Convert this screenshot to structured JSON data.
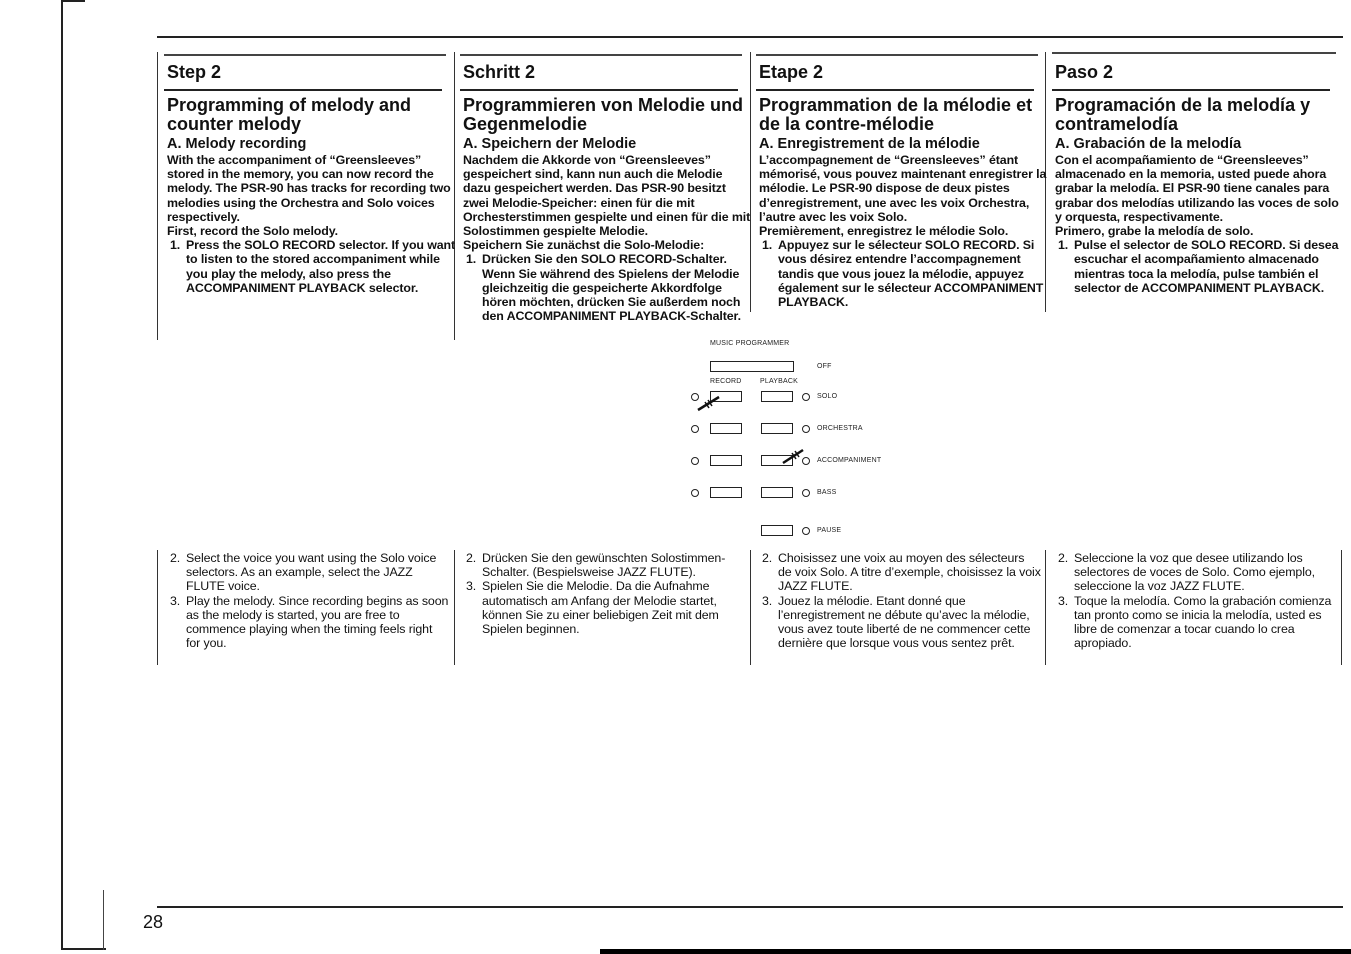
{
  "page_number": "28",
  "columns": [
    {
      "lang": "en",
      "step": "Step 2",
      "heading": "Programming of melody and counter melody",
      "subheading": "A. Melody recording",
      "intro": "With the accompaniment of “Greensleeves” stored in the memory, you can now record the melody. The PSR-90 has tracks for recording two melodies using the Orchestra and Solo voices respectively.",
      "first": "First, record the Solo melody.",
      "steps_top": [
        {
          "num": "1.",
          "text": "Press the SOLO RECORD selector. If you want to listen to the stored accompaniment while you play the melody, also press the ACCOMPANIMENT PLAYBACK selector."
        }
      ],
      "steps_bottom": [
        {
          "num": "2.",
          "text": "Select the voice you want using the Solo voice selectors. As an example, select the JAZZ FLUTE voice."
        },
        {
          "num": "3.",
          "text": "Play the melody. Since recording begins as soon as the melody is started, you are free to commence playing when the timing feels right for you."
        }
      ]
    },
    {
      "lang": "de",
      "step": "Schritt 2",
      "heading": "Programmieren von Melodie und Gegenmelodie",
      "subheading": "A. Speichern der Melodie",
      "intro": "Nachdem die Akkorde von “Greensleeves” gespeichert sind, kann nun auch die Melodie dazu gespeichert werden. Das PSR-90 besitzt zwei Melodie-Speicher: einen für die mit Orchesterstimmen gespielte und einen für die mit Solostimmen gespielte Melodie.",
      "first": "Speichern Sie zunächst die Solo-Melodie:",
      "steps_top": [
        {
          "num": "1.",
          "text": "Drücken Sie den SOLO RECORD-Schalter. Wenn Sie während des Spielens der Melodie gleichzeitig die gespeicherte Akkordfolge hören möchten, drücken Sie außerdem noch den ACCOMPANIMENT PLAYBACK-Schalter."
        }
      ],
      "steps_bottom": [
        {
          "num": "2.",
          "text": "Drücken Sie den gewünschten Solostimmen-Schalter. (Bespielsweise JAZZ FLUTE)."
        },
        {
          "num": "3.",
          "text": "Spielen Sie die Melodie. Da die Aufnahme automatisch am Anfang der Melodie startet, können Sie zu einer beliebigen Zeit mit dem Spielen beginnen."
        }
      ]
    },
    {
      "lang": "fr",
      "step": "Etape 2",
      "heading": "Programmation de la mélodie et de la contre-mélodie",
      "subheading": "A. Enregistrement de la mélodie",
      "intro": "L’accompagnement de “Greensleeves” étant mémorisé, vous pouvez maintenant enregistrer la mélodie. Le PSR-90 dispose de deux pistes d’enregistrement, une avec les voix Orchestra, l’autre avec les voix Solo.",
      "first": "Premièrement, enregistrez le mélodie Solo.",
      "steps_top": [
        {
          "num": "1.",
          "text": "Appuyez sur le sélecteur SOLO RECORD. Si vous désirez entendre l’accompagnement tandis que vous jouez la mélodie, appuyez également sur le sélecteur ACCOMPANIMENT PLAYBACK."
        }
      ],
      "steps_bottom": [
        {
          "num": "2.",
          "text": "Choisissez une voix au moyen des sélecteurs de voix Solo. A titre d’exemple, choisissez la voix JAZZ FLUTE."
        },
        {
          "num": "3.",
          "text": "Jouez la mélodie. Etant donné que l’enregistrement ne débute qu’avec la mélodie, vous avez toute liberté de ne commencer cette dernière que lorsque vous vous sentez prêt."
        }
      ]
    },
    {
      "lang": "es",
      "step": "Paso 2",
      "heading": "Programación de la melodía y contramelodía",
      "subheading": "A. Grabación de la melodía",
      "intro": "Con el acompañamiento de “Greensleeves” almacenado en la memoria, usted puede ahora grabar la melodía. El PSR-90 tiene canales para grabar dos melodías utilizando las voces de solo y orquesta, respectivamente.",
      "first": "Primero, grabe la melodía de solo.",
      "steps_top": [
        {
          "num": "1.",
          "text": "Pulse el selector de SOLO RECORD. Si desea escuchar el acompañamiento almacenado mientras toca la melodía, pulse también el selector de ACCOMPANIMENT PLAYBACK."
        }
      ],
      "steps_bottom": [
        {
          "num": "2.",
          "text": "Seleccione la voz que desee utilizando los selectores de voces de Solo. Como ejemplo, seleccione la voz JAZZ FLUTE."
        },
        {
          "num": "3.",
          "text": "Toque la melodía. Como la grabación comienza tan pronto como se inicia la melodía, usted es libre de comenzar a tocar cuando lo crea apropiado."
        }
      ]
    }
  ],
  "diagram": {
    "title": "MUSIC PROGRAMMER",
    "off_label": "OFF",
    "record_label": "RECORD",
    "playback_label": "PLAYBACK",
    "rows": [
      {
        "label": "SOLO",
        "record_pressed": true,
        "playback_pressed": false
      },
      {
        "label": "ORCHESTRA",
        "record_pressed": false,
        "playback_pressed": false
      },
      {
        "label": "ACCOMPANIMENT",
        "record_pressed": false,
        "playback_pressed": true
      },
      {
        "label": "BASS",
        "record_pressed": false,
        "playback_pressed": false
      }
    ],
    "pause_label": "PAUSE"
  }
}
